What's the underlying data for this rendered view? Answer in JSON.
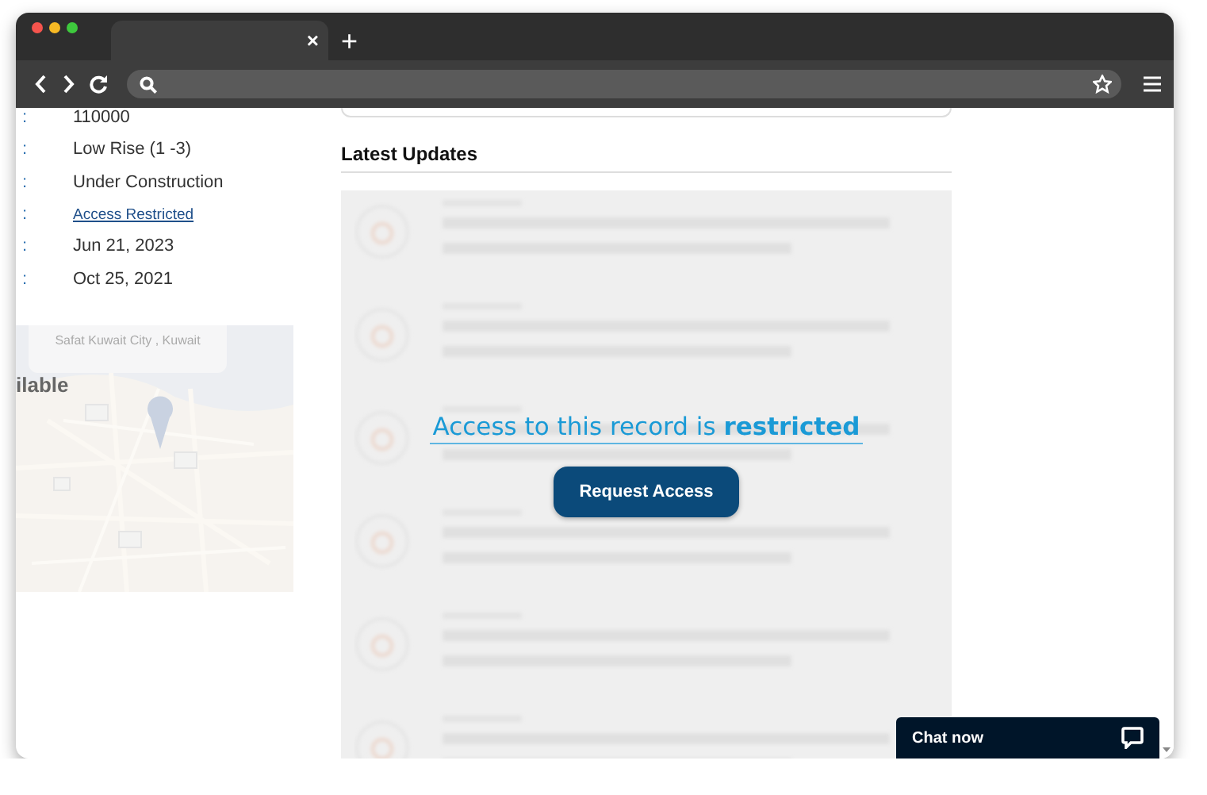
{
  "browser": {
    "tab": {
      "close": "×",
      "selected": true
    },
    "new_tab": "+"
  },
  "details": [
    {
      "separator": ":",
      "value": "110000",
      "kind": "text"
    },
    {
      "separator": ":",
      "value": "Low Rise (1 -3)",
      "kind": "text"
    },
    {
      "separator": ":",
      "value": "Under Construction",
      "kind": "text"
    },
    {
      "separator": ":",
      "value": "Access Restricted",
      "kind": "link"
    },
    {
      "separator": ":",
      "value": "Jun 21, 2023",
      "kind": "text"
    },
    {
      "separator": ":",
      "value": "Oct 25, 2021",
      "kind": "text"
    }
  ],
  "map": {
    "kind": "picture",
    "popup": "Safat Kuwait City , Kuwait",
    "label": "ilable"
  },
  "latest_updates": {
    "title": "Latest Updates"
  },
  "restriction": {
    "message": "Access to this record is **restricted**",
    "button": "Request Access"
  },
  "chat": {
    "label": "Chat now"
  }
}
